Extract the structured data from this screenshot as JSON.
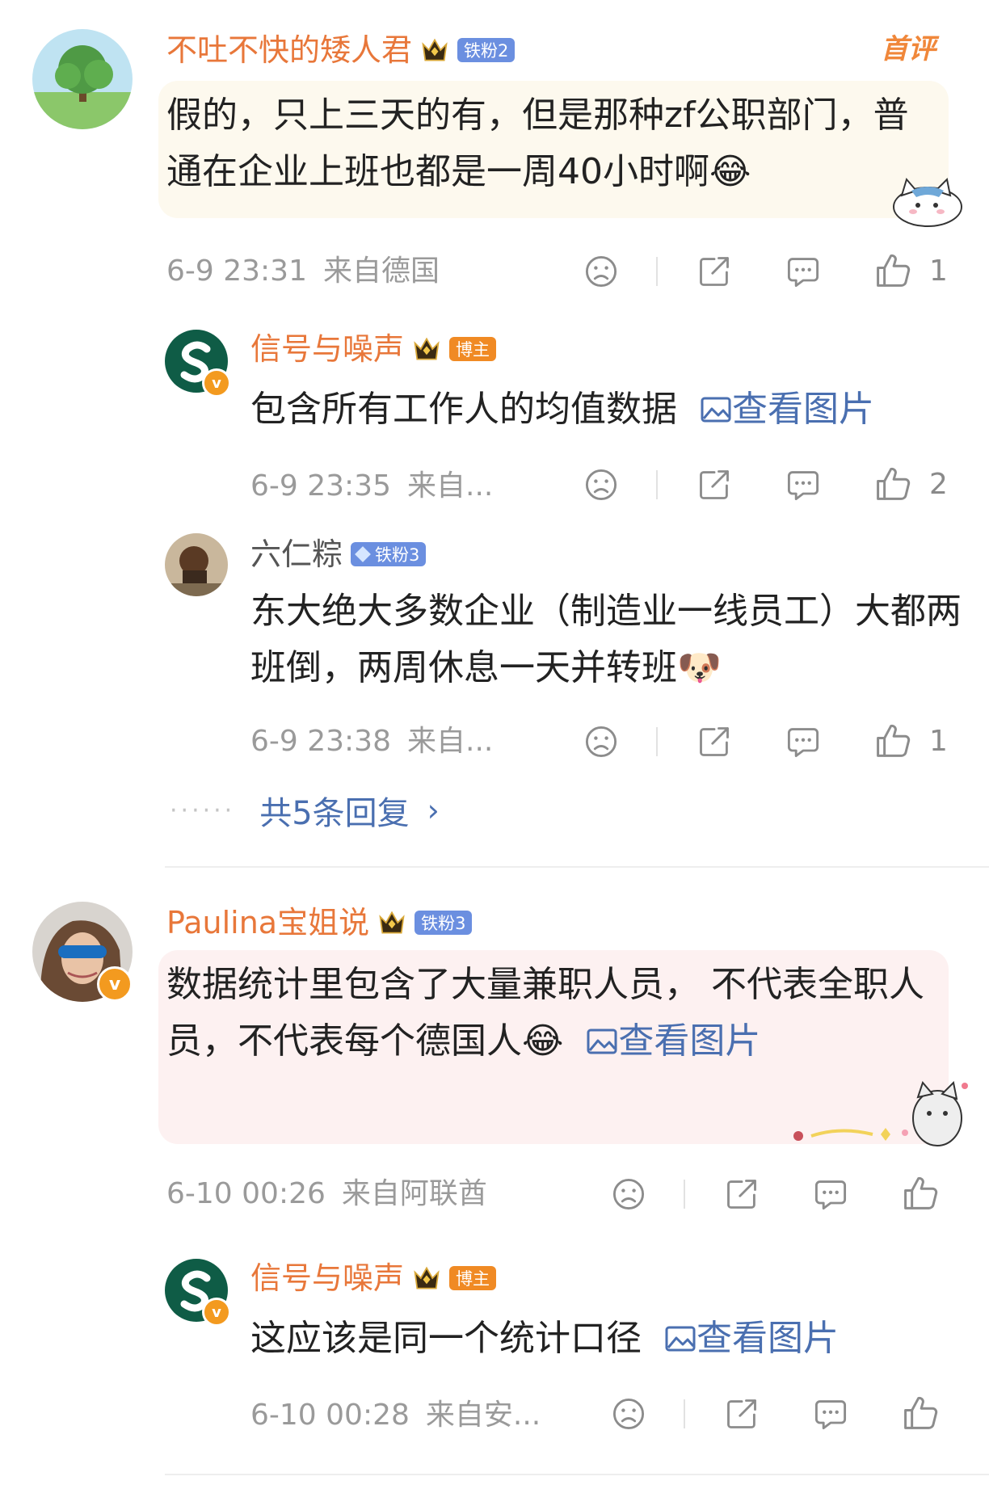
{
  "comments": [
    {
      "username": "不吐不快的矮人君",
      "fan_badge": "铁粉2",
      "first_tag": "首评",
      "text": "假的，只上三天的有，但是那种zf公职部门，普通在企业上班也都是一周40小时啊😂",
      "time": "6-9 23:31",
      "location": "来自德国",
      "likes": "1",
      "replies": [
        {
          "username": "信号与噪声",
          "role_badge": "博主",
          "text": "包含所有工作人的均值数据",
          "view_image": "查看图片",
          "time": "6-9 23:35",
          "location": "来自...",
          "likes": "2"
        },
        {
          "username": "六仁粽",
          "fan_badge": "铁粉3",
          "text": "东大绝大多数企业（制造业一线员工）大都两班倒，两周休息一天并转班🐶",
          "time": "6-9 23:38",
          "location": "来自...",
          "likes": "1"
        }
      ],
      "more_replies": "共5条回复"
    },
    {
      "username": "Paulina宝姐说",
      "fan_badge": "铁粉3",
      "text": "数据统计里包含了大量兼职人员， 不代表全职人员，不代表每个德国人😂",
      "view_image": "查看图片",
      "time": "6-10 00:26",
      "location": "来自阿联酋",
      "likes": "",
      "replies": [
        {
          "username": "信号与噪声",
          "role_badge": "博主",
          "text": "这应该是同一个统计口径",
          "view_image": "查看图片",
          "time": "6-10 00:28",
          "location": "来自安...",
          "likes": ""
        }
      ]
    }
  ],
  "icons": {
    "dislike": "face-frown-icon",
    "share": "share-icon",
    "comment": "comment-bubble-icon",
    "like": "thumbs-up-icon"
  },
  "colors": {
    "username": "#e8773a",
    "link": "#4a6fb0",
    "fan_badge": "#6b8fe0",
    "blogger_badge": "#f08a24"
  }
}
